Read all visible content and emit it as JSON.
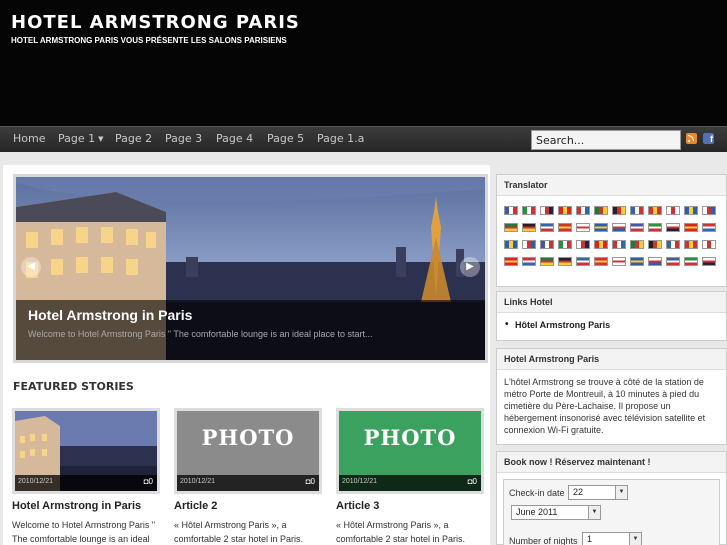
{
  "header": {
    "title": "HOTEL ARMSTRONG PARIS",
    "subtitle": "HOTEL ARMSTRONG PARIS VOUS PRÉSENTE LES SALONS PARISIENS"
  },
  "nav": {
    "items": [
      "Home",
      "Page 1",
      "Page 2",
      "Page 3",
      "Page 4",
      "Page 5",
      "Page 1.a"
    ],
    "search_value": "Search...",
    "icons": [
      "rss-icon",
      "facebook-icon"
    ]
  },
  "slider": {
    "title": "Hotel Armstrong in Paris",
    "text": "Welcome to Hotel Armstrong Paris \" The comfortable lounge is an ideal place to start...",
    "prev_icon": "chevron-left-icon",
    "next_icon": "chevron-right-icon"
  },
  "featured": {
    "heading": "FEATURED STORIES",
    "cards": [
      {
        "date": "2010/12/21",
        "comments": "0",
        "title": "Hotel Armstrong in Paris",
        "text_1": "Welcome to Hotel Armstrong Paris \"",
        "text_2": "The comfortable lounge is an ideal",
        "thumb": "paris-photo",
        "photo_label": ""
      },
      {
        "date": "2010/12/21",
        "comments": "0",
        "title": "Article 2",
        "text_1": "« Hôtel Armstrong Paris », a",
        "text_2": "comfortable 2 star hotel in Paris.",
        "thumb": "photo-placeholder-gray",
        "photo_label": "PHOTO"
      },
      {
        "date": "2010/12/21",
        "comments": "0",
        "title": "Article 3",
        "text_1": "« Hôtel Armstrong Paris », a",
        "text_2": "comfortable 2 star hotel in Paris.",
        "thumb": "photo-placeholder-green",
        "photo_label": "PHOTO"
      }
    ]
  },
  "sidebar": {
    "translator_title": "Translator",
    "links_title": "Links Hotel",
    "links_item": "Hôtel Armstrong Paris",
    "about_title": "Hotel Armstrong Paris",
    "about_text": "L'hôtel Armstrong se trouve à côté de la station de métro Porte de Montreuil, à 10 minutes à pied du cimetière du Père-Lachaise. Il propose un hébergement insonorisé avec télévision satellite et connexion Wi-Fi gratuite.",
    "booking_title": "Book now ! Réservez maintenant !",
    "checkin_label": "Check-in date",
    "checkin_day": "22",
    "checkin_month": "June 2011",
    "nights_label": "Number of nights",
    "nights_value": "1"
  },
  "colors": {
    "header_bg": "#050505",
    "nav_bg": "#2e2e2e",
    "page_bg": "#e9e9e9",
    "photo_gray": "#8b8b8b",
    "photo_green": "#3aa25e"
  }
}
